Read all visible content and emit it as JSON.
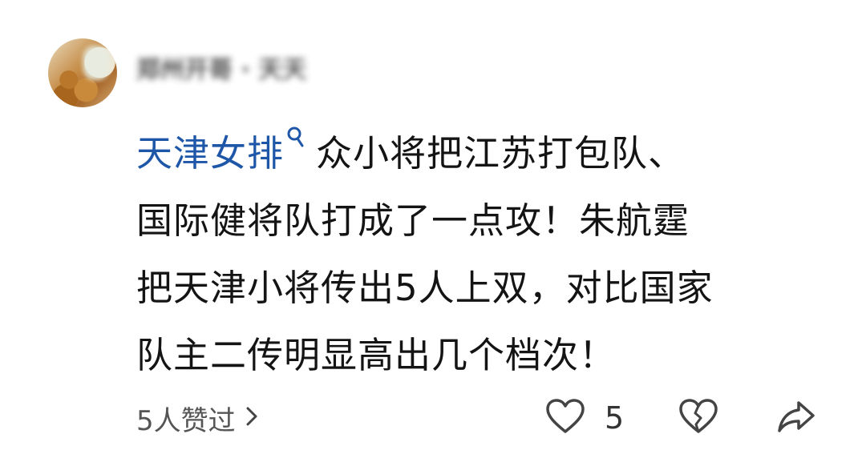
{
  "comment": {
    "author": {
      "name": "郑州开哥 · 天天"
    },
    "topic": "天津女排",
    "body_lines": [
      "众小将把江苏打包队、",
      "国际健将队打成了一点攻！朱航霆",
      "把天津小将传出5人上双，对比国家",
      "队主二传明显高出几个档次！"
    ]
  },
  "footer": {
    "liked_by": "5人赞过",
    "like_count": "5"
  },
  "icons": {
    "topic_search": "search-icon",
    "expand": "chevron-right-icon",
    "like": "heart-icon",
    "dislike": "broken-heart-icon",
    "share": "share-icon"
  },
  "colors": {
    "topic_link": "#1f57a8",
    "text": "#141414",
    "secondary_text": "#555555",
    "icon": "#444444"
  }
}
